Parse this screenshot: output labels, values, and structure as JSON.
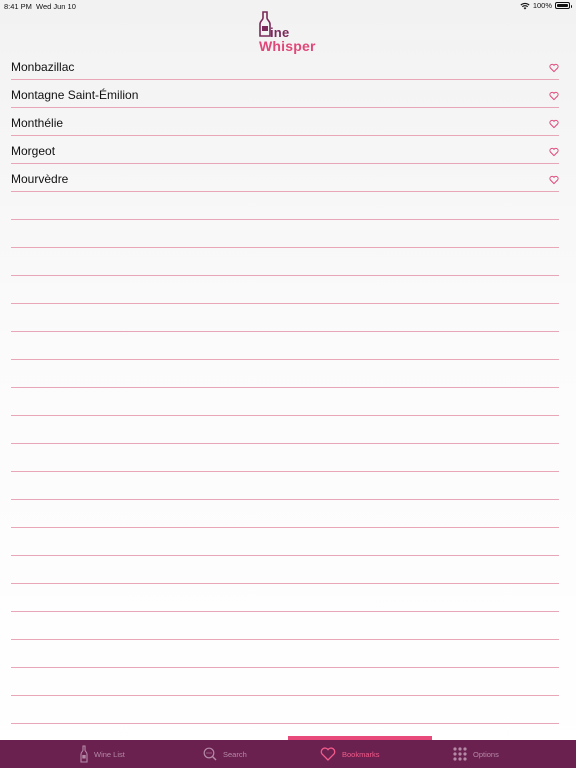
{
  "status_bar": {
    "time": "8:41 PM",
    "date": "Wed Jun 10",
    "battery": "100%",
    "wifi_icon": "wifi-icon",
    "battery_icon": "battery-icon"
  },
  "header": {
    "logo_line1": "ine",
    "logo_line2": "Whisper",
    "logo_icon": "bottle-icon"
  },
  "bookmarks": [
    {
      "label": "Monbazillac",
      "icon": "heart-icon"
    },
    {
      "label": "Montagne Saint-Émilion",
      "icon": "heart-icon"
    },
    {
      "label": "Monthélie",
      "icon": "heart-icon"
    },
    {
      "label": "Morgeot",
      "icon": "heart-icon"
    },
    {
      "label": "Mourvèdre",
      "icon": "heart-icon"
    }
  ],
  "tabs": [
    {
      "label": "Wine List",
      "icon": "bottle-icon",
      "active": false
    },
    {
      "label": "Search",
      "icon": "search-icon",
      "active": false
    },
    {
      "label": "Bookmarks",
      "icon": "heart-icon",
      "active": true
    },
    {
      "label": "Options",
      "icon": "grid-icon",
      "active": false
    }
  ],
  "colors": {
    "tab_bar": "#6b2150",
    "accent": "#e94a7c",
    "divider": "#e8a6b8",
    "logo_dark": "#7a2a5a",
    "logo_pink": "#e0487a"
  }
}
